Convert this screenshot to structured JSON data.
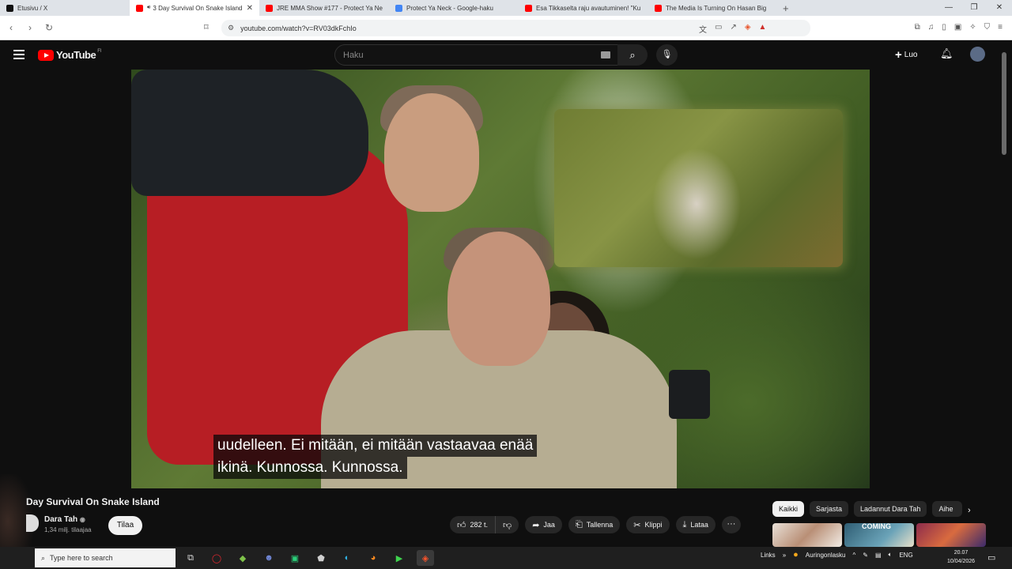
{
  "browser": {
    "tabs": [
      {
        "label": "Etusivu / X",
        "favicon": "x-icon",
        "color": "#111111"
      },
      {
        "label": "3 Day Survival On Snake Island",
        "favicon": "youtube-icon",
        "color": "#ff0000",
        "active": true,
        "playing": true
      },
      {
        "label": "JRE MMA Show #177 - Protect Ya Ne",
        "favicon": "youtube-icon",
        "color": "#ff0000"
      },
      {
        "label": "Protect Ya Neck - Google-haku",
        "favicon": "google-icon",
        "color": "#4285f4"
      },
      {
        "label": "Esa Tikkaselta raju avautuminen! \"Ku",
        "favicon": "youtube-icon",
        "color": "#ff0000"
      },
      {
        "label": "The Media Is Turning On Hasan Big",
        "favicon": "youtube-icon",
        "color": "#ff0000"
      }
    ],
    "new_tab": "+",
    "url": "youtube.com/watch?v=RV03dkFchIo"
  },
  "youtube": {
    "logo_text": "YouTube",
    "region": "FI",
    "search_placeholder": "Haku",
    "create_label": "Luo"
  },
  "video": {
    "subtitles": [
      "uudelleen.  Ei mitään, ei mitään vastaavaa enää",
      "ikinä.  Kunnossa.  Kunnossa."
    ],
    "title": "Day Survival On Snake Island",
    "channel": {
      "name": "Dara Tah",
      "subscribers": "1,34 milj. tilaajaa",
      "verified": true
    },
    "subscribe_label": "Tilaa",
    "actions": {
      "likes": "282 t.",
      "share": "Jaa",
      "save": "Tallenna",
      "clip": "Klippi",
      "download": "Lataa",
      "more": "···"
    }
  },
  "recommendations": {
    "chips": [
      "Kaikki",
      "Sarjasta",
      "Ladannut Dara Tah",
      "Aihe"
    ],
    "thumb_text": "COMING"
  },
  "taskbar": {
    "search_placeholder": "Type here to search",
    "tray_links": "Links",
    "weather": "Auringonlasku",
    "language": "ENG",
    "time": "20.07",
    "date": "10/04/2026"
  }
}
